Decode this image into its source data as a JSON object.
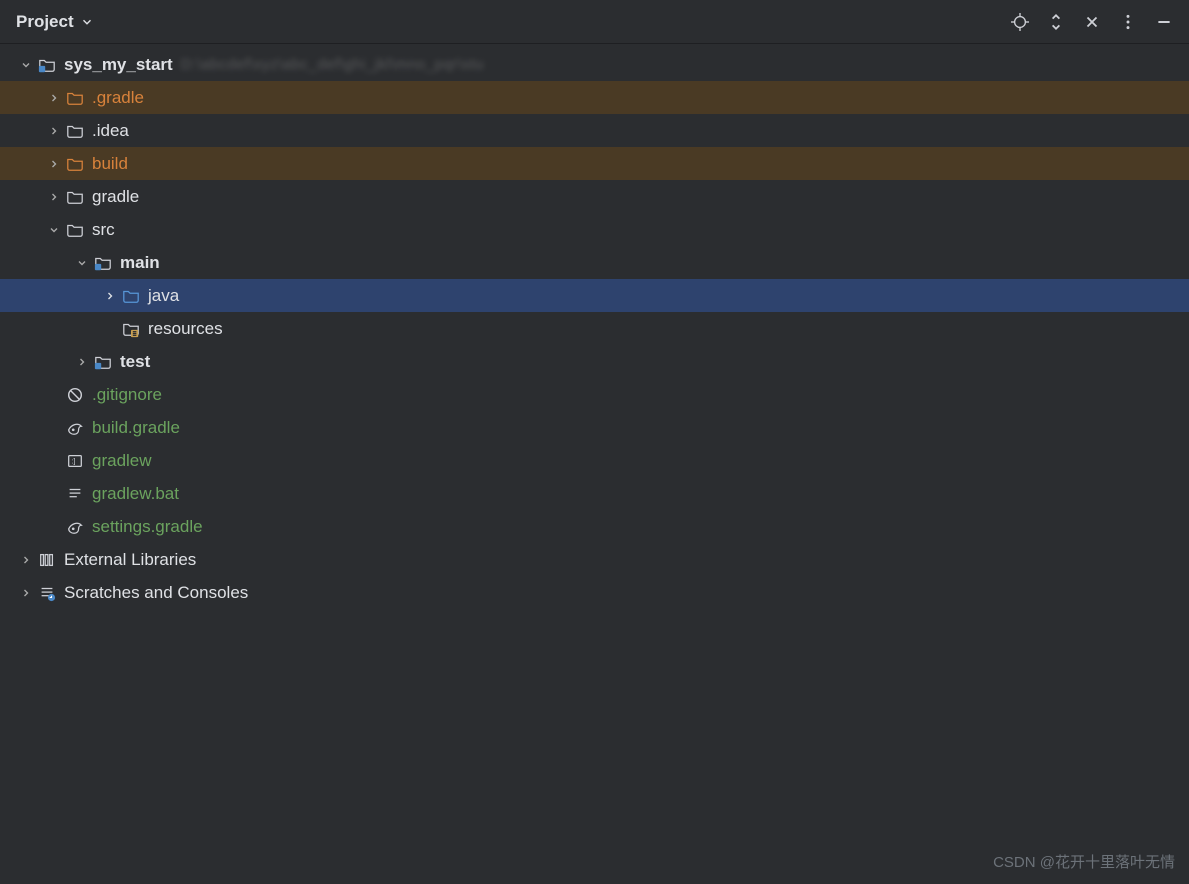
{
  "header": {
    "title": "Project"
  },
  "tree": {
    "root": {
      "label": "sys_my_start",
      "path_blur": "D:\\abcdef\\xyz\\abc_def\\ghi_jkl\\mno_pqr\\stu"
    },
    "gradle_excluded": {
      "label": ".gradle"
    },
    "idea": {
      "label": ".idea"
    },
    "build": {
      "label": "build"
    },
    "gradle_dir": {
      "label": "gradle"
    },
    "src": {
      "label": "src"
    },
    "main": {
      "label": "main"
    },
    "java": {
      "label": "java"
    },
    "resources": {
      "label": "resources"
    },
    "test": {
      "label": "test"
    },
    "gitignore": {
      "label": ".gitignore"
    },
    "build_gradle": {
      "label": "build.gradle"
    },
    "gradlew": {
      "label": "gradlew"
    },
    "gradlew_bat": {
      "label": "gradlew.bat"
    },
    "settings_gradle": {
      "label": "settings.gradle"
    },
    "external_libs": {
      "label": "External Libraries"
    },
    "scratches": {
      "label": "Scratches and Consoles"
    }
  },
  "watermark": "CSDN @花开十里落叶无情"
}
